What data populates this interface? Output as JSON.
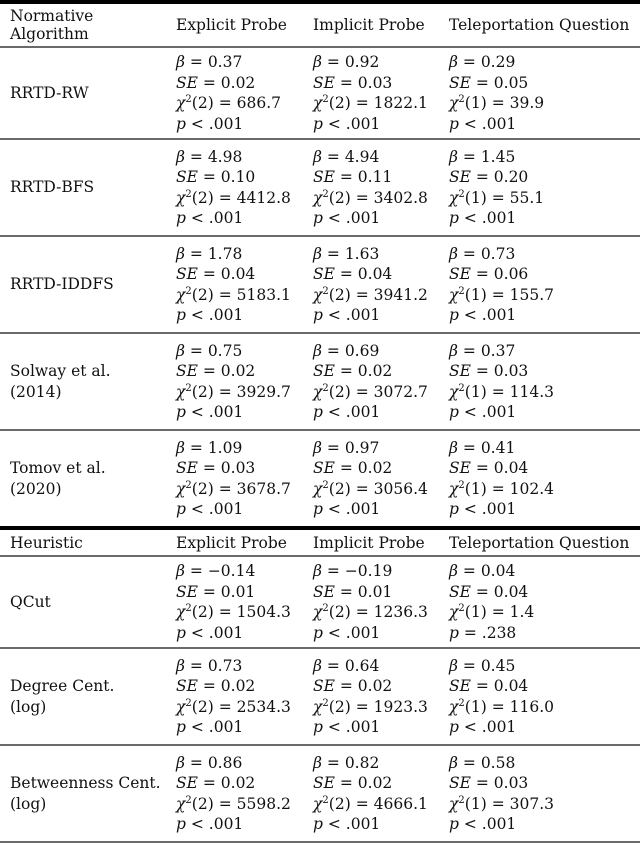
{
  "sections": [
    {
      "header": {
        "label_line1": "Normative",
        "label_line2": "Algorithm",
        "columns": [
          "Explicit Probe",
          "Implicit Probe",
          "Teleportation Question"
        ]
      },
      "rows": [
        {
          "label_line1": "RRTD-RW",
          "label_line2": "",
          "cells": [
            {
              "beta": "0.37",
              "se": "0.02",
              "df": "2",
              "chi2": "686.7",
              "p_op": "<",
              "p": ".001"
            },
            {
              "beta": "0.92",
              "se": "0.03",
              "df": "2",
              "chi2": "1822.1",
              "p_op": "<",
              "p": ".001"
            },
            {
              "beta": "0.29",
              "se": "0.05",
              "df": "1",
              "chi2": "39.9",
              "p_op": "<",
              "p": ".001"
            }
          ]
        },
        {
          "label_line1": "RRTD-BFS",
          "label_line2": "",
          "cells": [
            {
              "beta": "4.98",
              "se": "0.10",
              "df": "2",
              "chi2": "4412.8",
              "p_op": "<",
              "p": ".001"
            },
            {
              "beta": "4.94",
              "se": "0.11",
              "df": "2",
              "chi2": "3402.8",
              "p_op": "<",
              "p": ".001"
            },
            {
              "beta": "1.45",
              "se": "0.20",
              "df": "1",
              "chi2": "55.1",
              "p_op": "<",
              "p": ".001"
            }
          ]
        },
        {
          "label_line1": "RRTD-IDDFS",
          "label_line2": "",
          "cells": [
            {
              "beta": "1.78",
              "se": "0.04",
              "df": "2",
              "chi2": "5183.1",
              "p_op": "<",
              "p": ".001"
            },
            {
              "beta": "1.63",
              "se": "0.04",
              "df": "2",
              "chi2": "3941.2",
              "p_op": "<",
              "p": ".001"
            },
            {
              "beta": "0.73",
              "se": "0.06",
              "df": "1",
              "chi2": "155.7",
              "p_op": "<",
              "p": ".001"
            }
          ]
        },
        {
          "label_line1": "Solway et al.",
          "label_line2": "(2014)",
          "cells": [
            {
              "beta": "0.75",
              "se": "0.02",
              "df": "2",
              "chi2": "3929.7",
              "p_op": "<",
              "p": ".001"
            },
            {
              "beta": "0.69",
              "se": "0.02",
              "df": "2",
              "chi2": "3072.7",
              "p_op": "<",
              "p": ".001"
            },
            {
              "beta": "0.37",
              "se": "0.03",
              "df": "1",
              "chi2": "114.3",
              "p_op": "<",
              "p": ".001"
            }
          ]
        },
        {
          "label_line1": "Tomov et al.",
          "label_line2": "(2020)",
          "cells": [
            {
              "beta": "1.09",
              "se": "0.03",
              "df": "2",
              "chi2": "3678.7",
              "p_op": "<",
              "p": ".001"
            },
            {
              "beta": "0.97",
              "se": "0.02",
              "df": "2",
              "chi2": "3056.4",
              "p_op": "<",
              "p": ".001"
            },
            {
              "beta": "0.41",
              "se": "0.04",
              "df": "1",
              "chi2": "102.4",
              "p_op": "<",
              "p": ".001"
            }
          ]
        }
      ]
    },
    {
      "header": {
        "label_line1": "Heuristic",
        "label_line2": "",
        "columns": [
          "Explicit Probe",
          "Implicit Probe",
          "Teleportation Question"
        ]
      },
      "rows": [
        {
          "label_line1": "QCut",
          "label_line2": "",
          "cells": [
            {
              "beta": "−0.14",
              "se": "0.01",
              "df": "2",
              "chi2": "1504.3",
              "p_op": "<",
              "p": ".001"
            },
            {
              "beta": "−0.19",
              "se": "0.01",
              "df": "2",
              "chi2": "1236.3",
              "p_op": "<",
              "p": ".001"
            },
            {
              "beta": "0.04",
              "se": "0.04",
              "df": "1",
              "chi2": "1.4",
              "p_op": "=",
              "p": ".238"
            }
          ]
        },
        {
          "label_line1": "Degree Cent.",
          "label_line2": "(log)",
          "cells": [
            {
              "beta": "0.73",
              "se": "0.02",
              "df": "2",
              "chi2": "2534.3",
              "p_op": "<",
              "p": ".001"
            },
            {
              "beta": "0.64",
              "se": "0.02",
              "df": "2",
              "chi2": "1923.3",
              "p_op": "<",
              "p": ".001"
            },
            {
              "beta": "0.45",
              "se": "0.04",
              "df": "1",
              "chi2": "116.0",
              "p_op": "<",
              "p": ".001"
            }
          ]
        },
        {
          "label_line1": "Betweenness Cent.",
          "label_line2": "(log)",
          "cells": [
            {
              "beta": "0.86",
              "se": "0.02",
              "df": "2",
              "chi2": "5598.2",
              "p_op": "<",
              "p": ".001"
            },
            {
              "beta": "0.82",
              "se": "0.02",
              "df": "2",
              "chi2": "4666.1",
              "p_op": "<",
              "p": ".001"
            },
            {
              "beta": "0.58",
              "se": "0.03",
              "df": "1",
              "chi2": "307.3",
              "p_op": "<",
              "p": ".001"
            }
          ]
        }
      ]
    }
  ],
  "symbols": {
    "beta": "β",
    "se": "SE",
    "chi": "χ",
    "chi_exp": "2",
    "p": "p",
    "eq": " = "
  }
}
